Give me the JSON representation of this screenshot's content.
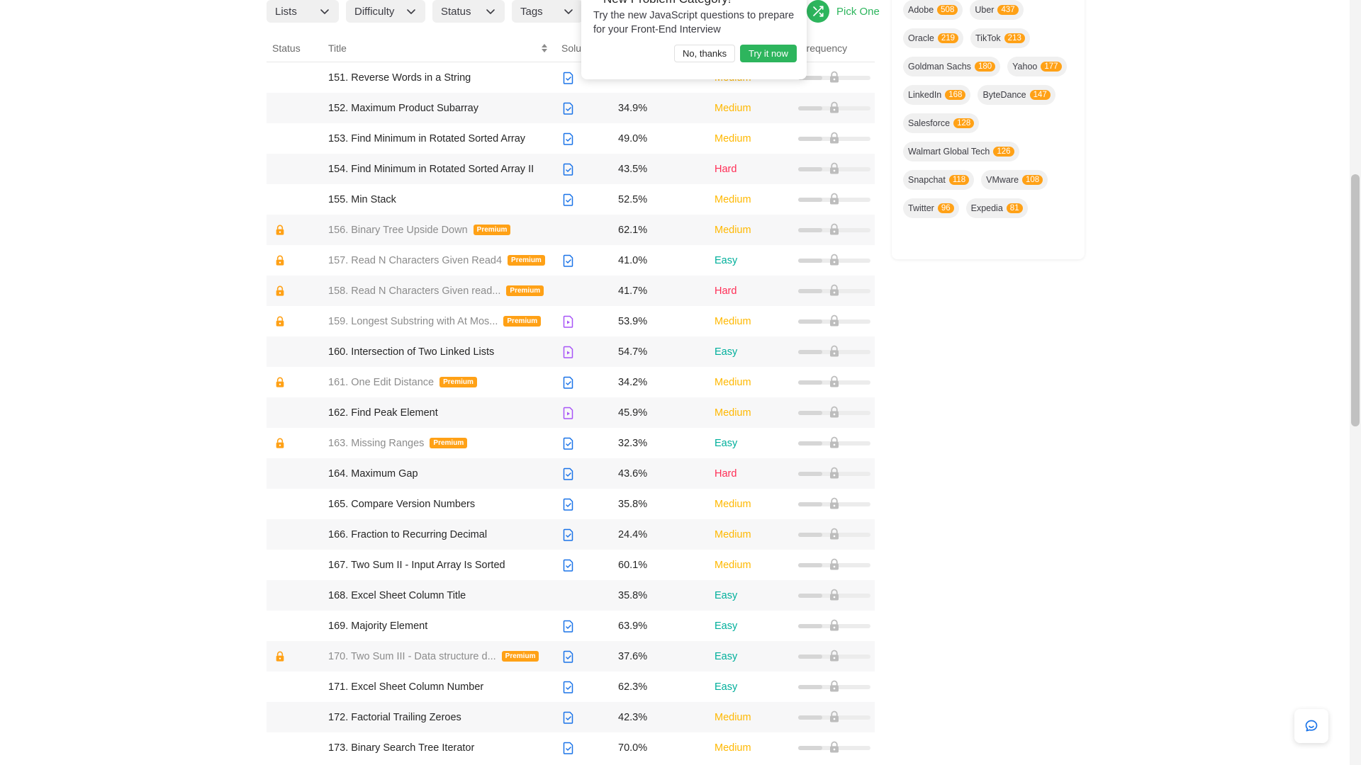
{
  "filters": [
    {
      "label": "Lists",
      "width": 102
    },
    {
      "label": "Difficulty",
      "width": 112
    },
    {
      "label": "Status",
      "width": 102
    },
    {
      "label": "Tags",
      "width": 100
    }
  ],
  "pick_one": {
    "label": "Pick One"
  },
  "popup": {
    "title": "New Problem Category!",
    "text": "Try the new JavaScript questions to prepare for your Front-End Interview",
    "no_label": "No, thanks",
    "try_label": "Try it now"
  },
  "table": {
    "headers": {
      "status": "Status",
      "title": "Title",
      "solution": "Solution",
      "frequency": "Frequency"
    },
    "rows": [
      {
        "title": "151. Reverse Words in a String",
        "locked": false,
        "premium": false,
        "solution": "blue",
        "acceptance": "",
        "difficulty": "Medium"
      },
      {
        "title": "152. Maximum Product Subarray",
        "locked": false,
        "premium": false,
        "solution": "blue",
        "acceptance": "34.9%",
        "difficulty": "Medium"
      },
      {
        "title": "153. Find Minimum in Rotated Sorted Array",
        "locked": false,
        "premium": false,
        "solution": "blue",
        "acceptance": "49.0%",
        "difficulty": "Medium"
      },
      {
        "title": "154. Find Minimum in Rotated Sorted Array II",
        "locked": false,
        "premium": false,
        "solution": "blue",
        "acceptance": "43.5%",
        "difficulty": "Hard"
      },
      {
        "title": "155. Min Stack",
        "locked": false,
        "premium": false,
        "solution": "blue",
        "acceptance": "52.5%",
        "difficulty": "Medium"
      },
      {
        "title": "156. Binary Tree Upside Down",
        "locked": true,
        "premium": true,
        "solution": "",
        "acceptance": "62.1%",
        "difficulty": "Medium"
      },
      {
        "title": "157. Read N Characters Given Read4",
        "locked": true,
        "premium": true,
        "solution": "blue",
        "acceptance": "41.0%",
        "difficulty": "Easy"
      },
      {
        "title": "158. Read N Characters Given read...",
        "locked": true,
        "premium": true,
        "solution": "",
        "acceptance": "41.7%",
        "difficulty": "Hard"
      },
      {
        "title": "159. Longest Substring with At Mos...",
        "locked": true,
        "premium": true,
        "solution": "purple",
        "acceptance": "53.9%",
        "difficulty": "Medium"
      },
      {
        "title": "160. Intersection of Two Linked Lists",
        "locked": false,
        "premium": false,
        "solution": "purple",
        "acceptance": "54.7%",
        "difficulty": "Easy"
      },
      {
        "title": "161. One Edit Distance",
        "locked": true,
        "premium": true,
        "solution": "blue",
        "acceptance": "34.2%",
        "difficulty": "Medium"
      },
      {
        "title": "162. Find Peak Element",
        "locked": false,
        "premium": false,
        "solution": "purple",
        "acceptance": "45.9%",
        "difficulty": "Medium"
      },
      {
        "title": "163. Missing Ranges",
        "locked": true,
        "premium": true,
        "solution": "blue",
        "acceptance": "32.3%",
        "difficulty": "Easy"
      },
      {
        "title": "164. Maximum Gap",
        "locked": false,
        "premium": false,
        "solution": "blue",
        "acceptance": "43.6%",
        "difficulty": "Hard"
      },
      {
        "title": "165. Compare Version Numbers",
        "locked": false,
        "premium": false,
        "solution": "blue",
        "acceptance": "35.8%",
        "difficulty": "Medium"
      },
      {
        "title": "166. Fraction to Recurring Decimal",
        "locked": false,
        "premium": false,
        "solution": "blue",
        "acceptance": "24.4%",
        "difficulty": "Medium"
      },
      {
        "title": "167. Two Sum II - Input Array Is Sorted",
        "locked": false,
        "premium": false,
        "solution": "blue",
        "acceptance": "60.1%",
        "difficulty": "Medium"
      },
      {
        "title": "168. Excel Sheet Column Title",
        "locked": false,
        "premium": false,
        "solution": "",
        "acceptance": "35.8%",
        "difficulty": "Easy"
      },
      {
        "title": "169. Majority Element",
        "locked": false,
        "premium": false,
        "solution": "blue",
        "acceptance": "63.9%",
        "difficulty": "Easy"
      },
      {
        "title": "170. Two Sum III - Data structure d...",
        "locked": true,
        "premium": true,
        "solution": "blue",
        "acceptance": "37.6%",
        "difficulty": "Easy"
      },
      {
        "title": "171. Excel Sheet Column Number",
        "locked": false,
        "premium": false,
        "solution": "blue",
        "acceptance": "62.3%",
        "difficulty": "Easy"
      },
      {
        "title": "172. Factorial Trailing Zeroes",
        "locked": false,
        "premium": false,
        "solution": "blue",
        "acceptance": "42.3%",
        "difficulty": "Medium"
      },
      {
        "title": "173. Binary Search Tree Iterator",
        "locked": false,
        "premium": false,
        "solution": "blue",
        "acceptance": "70.0%",
        "difficulty": "Medium"
      }
    ],
    "premium_label": "Premium"
  },
  "companies": [
    {
      "name": "Adobe",
      "count": "508"
    },
    {
      "name": "Uber",
      "count": "437"
    },
    {
      "name": "Oracle",
      "count": "219"
    },
    {
      "name": "TikTok",
      "count": "213"
    },
    {
      "name": "Goldman Sachs",
      "count": "180"
    },
    {
      "name": "Yahoo",
      "count": "177"
    },
    {
      "name": "LinkedIn",
      "count": "168"
    },
    {
      "name": "ByteDance",
      "count": "147"
    },
    {
      "name": "Salesforce",
      "count": "128"
    },
    {
      "name": "Walmart Global Tech",
      "count": "126"
    },
    {
      "name": "Snapchat",
      "count": "118"
    },
    {
      "name": "VMware",
      "count": "108"
    },
    {
      "name": "Twitter",
      "count": "96"
    },
    {
      "name": "Expedia",
      "count": "81"
    }
  ],
  "colors": {
    "accent_green": "#2db55d",
    "premium_orange": "#ffa116",
    "easy": "#00af9b",
    "medium": "#ffb800",
    "hard": "#ff2d55",
    "solution_blue": "#1a73e8",
    "solution_purple": "#a855f7"
  }
}
